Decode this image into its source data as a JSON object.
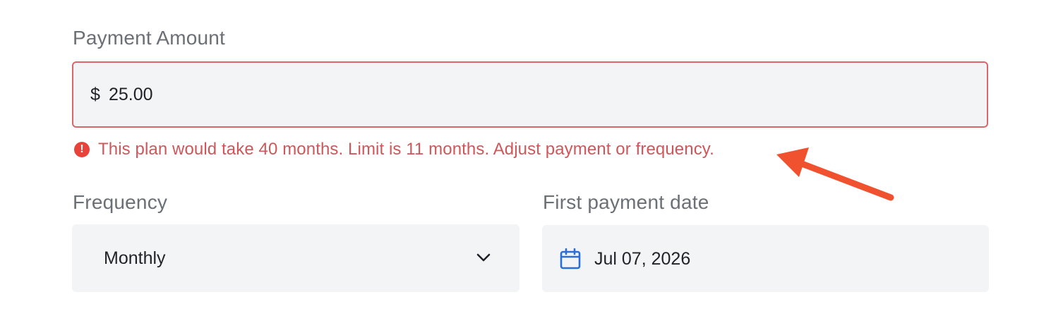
{
  "payment_amount": {
    "label": "Payment Amount",
    "currency_symbol": "$",
    "value": "25.00"
  },
  "error": {
    "icon": "exclamation-circle-icon",
    "message": "This plan would take 40 months. Limit is 11 months. Adjust payment or frequency.",
    "color": "#d0565a"
  },
  "frequency": {
    "label": "Frequency",
    "selected": "Monthly",
    "icon": "chevron-down-icon"
  },
  "first_payment_date": {
    "label": "First payment date",
    "value": "Jul 07, 2026",
    "icon": "calendar-icon",
    "icon_color": "#2b6fd6"
  },
  "annotation": {
    "type": "arrow",
    "color": "#f0522f"
  }
}
